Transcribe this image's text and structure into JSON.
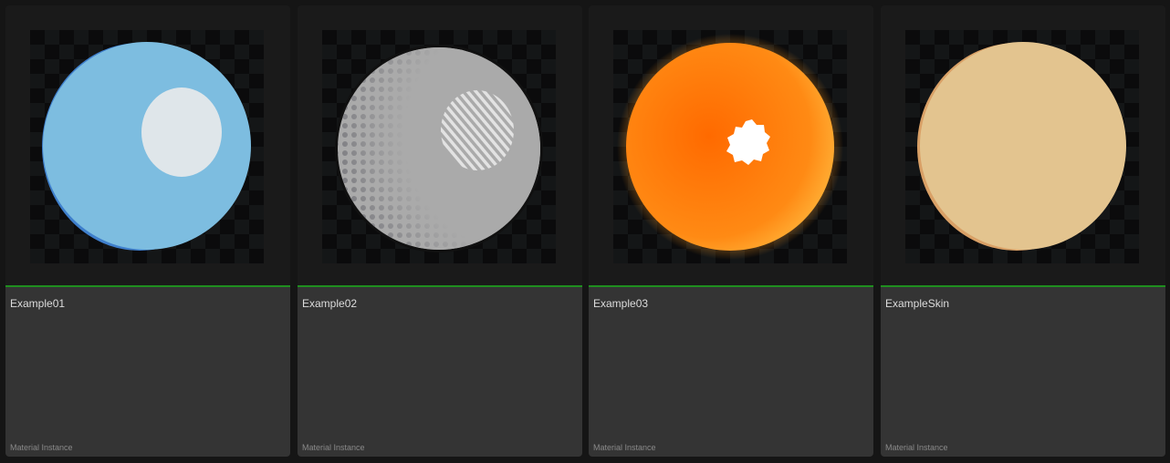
{
  "assets": [
    {
      "name": "Example01",
      "type": "Material Instance",
      "accent_color": "#1f8f1f",
      "sphere_color": "#7dbde0"
    },
    {
      "name": "Example02",
      "type": "Material Instance",
      "accent_color": "#1f8f1f",
      "sphere_color": "#a9a9a9"
    },
    {
      "name": "Example03",
      "type": "Material Instance",
      "accent_color": "#1f8f1f",
      "sphere_color": "#ff7a10"
    },
    {
      "name": "ExampleSkin",
      "type": "Material Instance",
      "accent_color": "#1f8f1f",
      "sphere_color": "#e3c48f"
    }
  ]
}
